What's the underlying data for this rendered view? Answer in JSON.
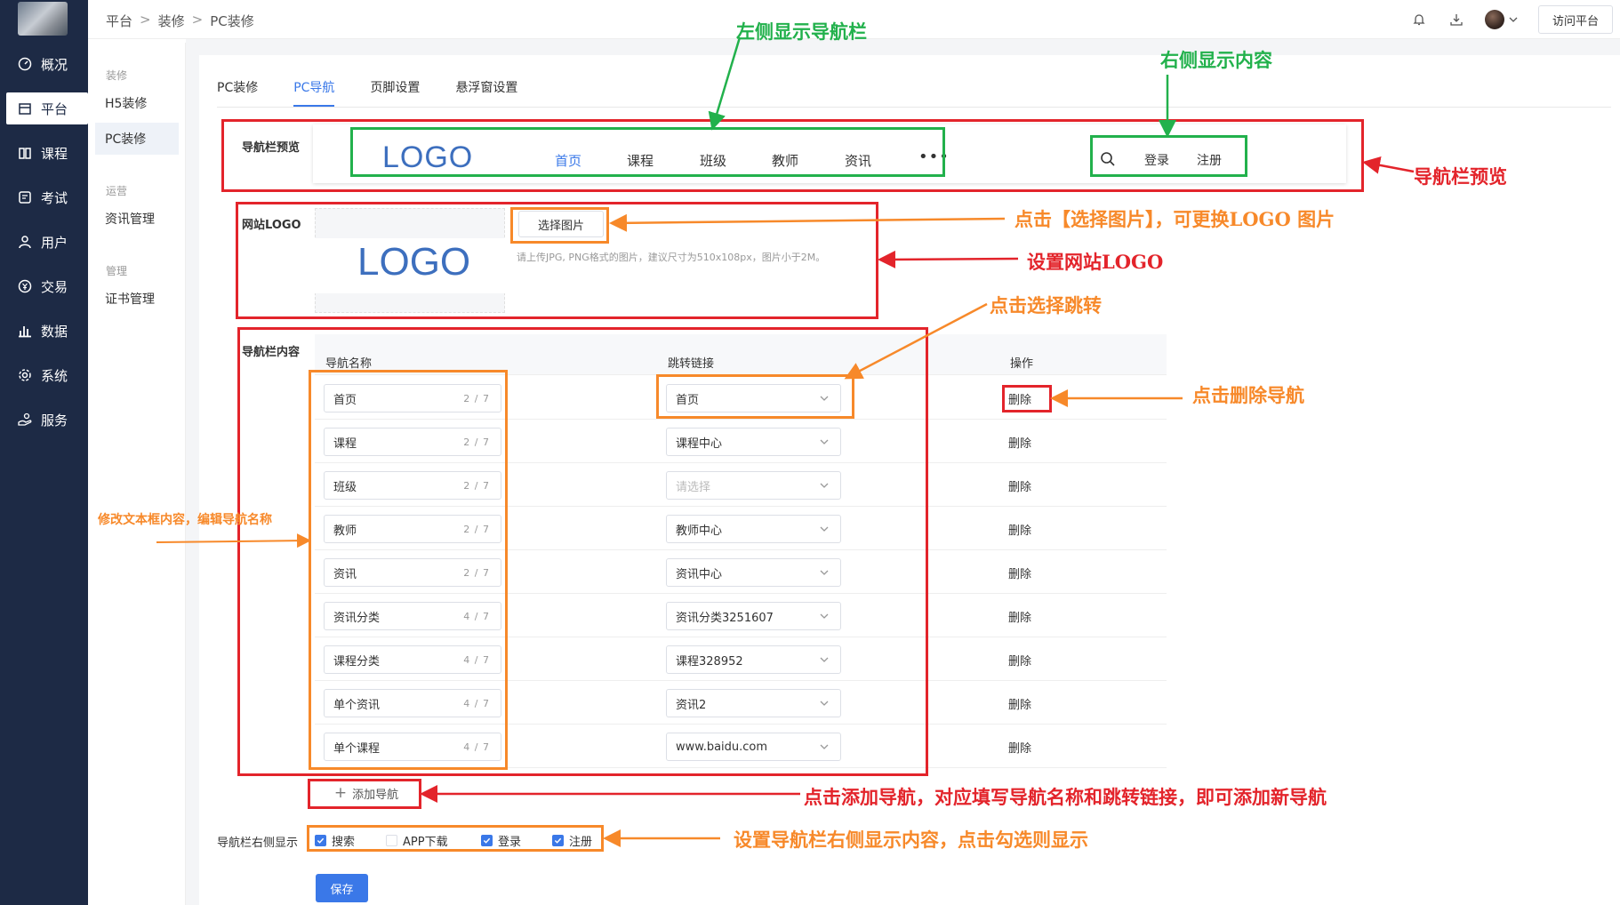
{
  "sidebar": {
    "items": [
      {
        "label": "概况",
        "icon": "gauge-icon"
      },
      {
        "label": "平台",
        "icon": "store-icon"
      },
      {
        "label": "课程",
        "icon": "book-icon"
      },
      {
        "label": "考试",
        "icon": "exam-icon"
      },
      {
        "label": "用户",
        "icon": "user-icon"
      },
      {
        "label": "交易",
        "icon": "yen-icon"
      },
      {
        "label": "数据",
        "icon": "bar-chart-icon"
      },
      {
        "label": "系统",
        "icon": "gear-icon"
      },
      {
        "label": "服务",
        "icon": "service-icon"
      }
    ],
    "active_index": 1
  },
  "submenu": {
    "group_decor": "装修",
    "group_ops": "运营",
    "group_mgmt": "管理",
    "h5": "H5装修",
    "pc": "PC装修",
    "news": "资讯管理",
    "cert": "证书管理"
  },
  "header": {
    "crumb1": "平台",
    "crumb2": "装修",
    "crumb3": "PC装修",
    "sep": ">",
    "visit": "访问平台"
  },
  "tabs": [
    "PC装修",
    "PC导航",
    "页脚设置",
    "悬浮窗设置"
  ],
  "active_tab": 1,
  "preview": {
    "label": "导航栏预览",
    "logo_text": "LOGO",
    "nav": [
      "首页",
      "课程",
      "班级",
      "教师",
      "资讯"
    ],
    "more": "•••",
    "login": "登录",
    "register": "注册"
  },
  "logo_setting": {
    "label": "网站LOGO",
    "logo_text": "LOGO",
    "choose_btn": "选择图片",
    "hint": "请上传JPG, PNG格式的图片，建议尺寸为510x108px，图片小于2M。"
  },
  "nav_content": {
    "label": "导航栏内容",
    "col_name": "导航名称",
    "col_link": "跳转链接",
    "col_op": "操作",
    "delete": "删除",
    "rows": [
      {
        "name": "首页",
        "count": "2 / 7",
        "link": "首页"
      },
      {
        "name": "课程",
        "count": "2 / 7",
        "link": "课程中心"
      },
      {
        "name": "班级",
        "count": "2 / 7",
        "link": "请选择",
        "placeholder": true
      },
      {
        "name": "教师",
        "count": "2 / 7",
        "link": "教师中心"
      },
      {
        "name": "资讯",
        "count": "2 / 7",
        "link": "资讯中心"
      },
      {
        "name": "资讯分类",
        "count": "4 / 7",
        "link": "资讯分类3251607"
      },
      {
        "name": "课程分类",
        "count": "4 / 7",
        "link": "课程328952"
      },
      {
        "name": "单个资讯",
        "count": "4 / 7",
        "link": "资讯2"
      },
      {
        "name": "单个课程",
        "count": "4 / 7",
        "link": "www.baidu.com"
      }
    ],
    "add_label": "添加导航",
    "add_icon": "+"
  },
  "right_display": {
    "label": "导航栏右侧显示",
    "options": [
      {
        "label": "搜索",
        "checked": true
      },
      {
        "label": "APP下载",
        "checked": false
      },
      {
        "label": "登录",
        "checked": true
      },
      {
        "label": "注册",
        "checked": true
      }
    ]
  },
  "save": "保存",
  "annotations": {
    "left_nav": "左侧显示导航栏",
    "right_content": "右侧显示内容",
    "preview": "导航栏预览",
    "choose_pic": "点击【选择图片】，可更换LOGO 图片",
    "set_logo": "设置网站LOGO",
    "choose_jump": "点击选择跳转",
    "delete_nav": "点击删除导航",
    "edit_name": "修改文本框内容，编辑导航名称",
    "add_nav": "点击添加导航，对应填写导航名称和跳转链接，即可添加新导航",
    "set_right": "设置导航栏右侧显示内容，点击勾选则显示"
  },
  "colors": {
    "sidebar_bg": "#1d2a45",
    "primary": "#3a78e8",
    "annot_red": "#e3242b",
    "annot_green": "#22b14c",
    "annot_orange": "#f7892a"
  }
}
